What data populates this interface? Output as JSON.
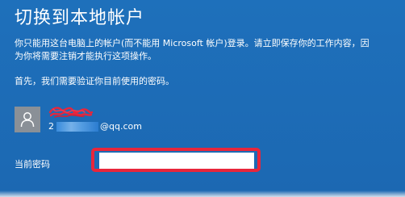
{
  "dialog": {
    "title": "切换到本地帐户",
    "description_lines": [
      "你只能用这台电脑上的帐户(而不能用 Microsoft 帐户)登录。请立即保存你的工作内容，因",
      "为你将需要注销才能执行这项操作。"
    ],
    "first_text": "首先，我们需要验证你目前使用的密码。"
  },
  "account": {
    "avatar_icon": "user-icon",
    "name_icon": "redacted-scribble",
    "email_prefix": "2",
    "email_domain": "@qq.com",
    "redaction_color": "#e8263b"
  },
  "password": {
    "label": "当前密码",
    "value": "",
    "placeholder": "",
    "highlight_color": "#e8263b"
  },
  "theme": {
    "background": "#1f6fb8",
    "text": "#ffffff"
  }
}
